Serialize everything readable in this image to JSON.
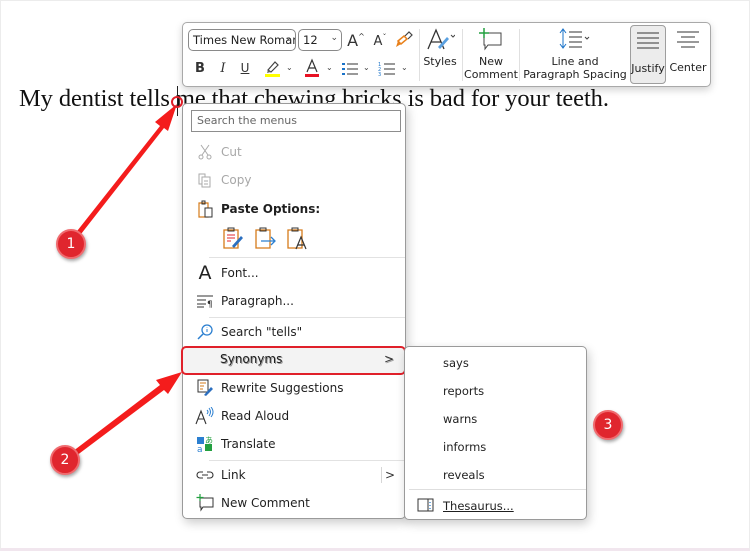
{
  "document": {
    "text": "My dentist tells me that chewing bricks is bad for your teeth."
  },
  "toolbar": {
    "font_name": "Times New Roman",
    "font_size": "12",
    "grow_font_icon": "A",
    "shrink_font_icon": "A",
    "bold": "B",
    "italic": "I",
    "underline": "U",
    "highlight_color": "#ffff00",
    "font_color": "#e81123",
    "styles_label": "Styles",
    "new_comment_line1": "New",
    "new_comment_line2": "Comment",
    "line_spacing_line1": "Line and",
    "line_spacing_line2": "Paragraph Spacing",
    "justify_label": "Justify",
    "center_label": "Center"
  },
  "context_menu": {
    "search_placeholder": "Search the menus",
    "cut": "Cut",
    "copy": "Copy",
    "paste_options": "Paste Options:",
    "font": "Font...",
    "paragraph": "Paragraph...",
    "search_word": "Search \"tells\"",
    "synonyms": "Synonyms",
    "rewrite": "Rewrite Suggestions",
    "read_aloud": "Read Aloud",
    "translate": "Translate",
    "link": "Link",
    "new_comment": "New Comment",
    "arrow": ">"
  },
  "synonyms_submenu": {
    "items": [
      "says",
      "reports",
      "warns",
      "informs",
      "reveals"
    ],
    "thesaurus": "Thesaurus..."
  },
  "annotations": {
    "badges": [
      "1",
      "2",
      "3"
    ],
    "color": "#e0262e"
  }
}
